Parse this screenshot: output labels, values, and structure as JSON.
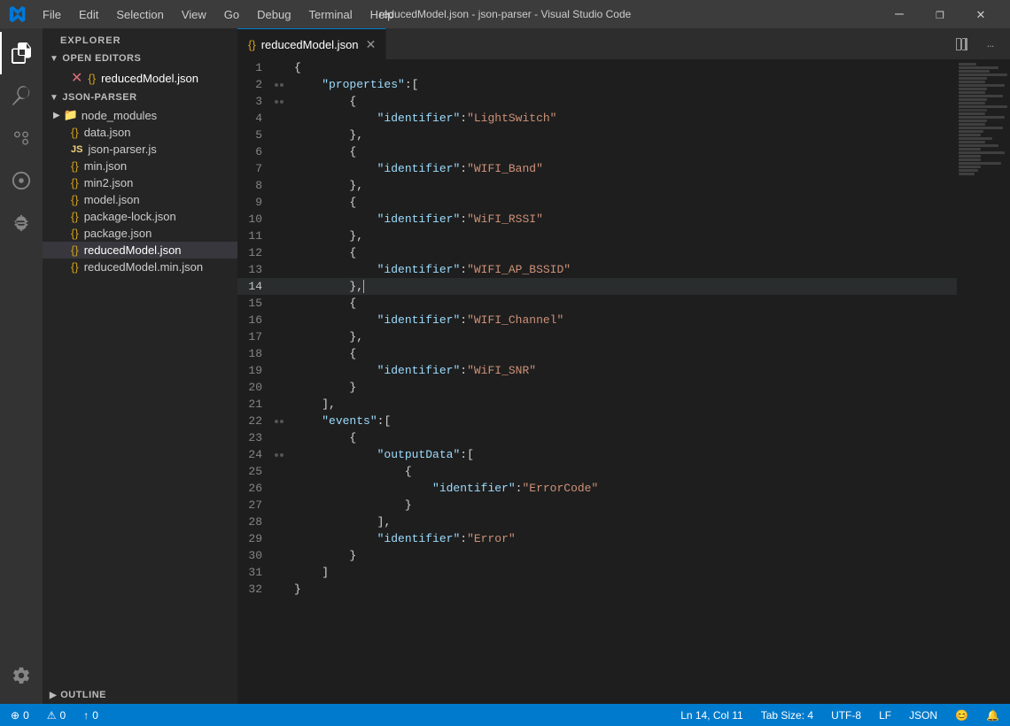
{
  "titlebar": {
    "title": "reducedModel.json - json-parser - Visual Studio Code",
    "menu_items": [
      "File",
      "Edit",
      "Selection",
      "View",
      "Go",
      "Debug",
      "Terminal",
      "Help"
    ],
    "controls": [
      "—",
      "❐",
      "✕"
    ]
  },
  "activity_bar": {
    "icons": [
      {
        "name": "explorer-icon",
        "symbol": "⎘",
        "active": true
      },
      {
        "name": "search-icon",
        "symbol": "🔍",
        "active": false
      },
      {
        "name": "source-control-icon",
        "symbol": "⎇",
        "active": false
      },
      {
        "name": "debug-icon",
        "symbol": "🐛",
        "active": false
      },
      {
        "name": "extensions-icon",
        "symbol": "⊞",
        "active": false
      }
    ],
    "bottom_icons": [
      {
        "name": "settings-icon",
        "symbol": "⚙"
      }
    ]
  },
  "sidebar": {
    "header": "EXPLORER",
    "sections": [
      {
        "name": "OPEN EDITORS",
        "open": true,
        "files": [
          {
            "icon": "{}",
            "name": "reducedModel.json",
            "active": true,
            "modified": true
          }
        ]
      },
      {
        "name": "JSON-PARSER",
        "open": true,
        "files": [
          {
            "type": "folder",
            "icon": "▶",
            "name": "node_modules",
            "indent": 1
          },
          {
            "type": "file",
            "icon": "{}",
            "name": "data.json",
            "indent": 1
          },
          {
            "type": "file",
            "icon": "JS",
            "name": "json-parser.js",
            "indent": 1
          },
          {
            "type": "file",
            "icon": "{}",
            "name": "min.json",
            "indent": 1
          },
          {
            "type": "file",
            "icon": "{}",
            "name": "min2.json",
            "indent": 1
          },
          {
            "type": "file",
            "icon": "{}",
            "name": "model.json",
            "indent": 1
          },
          {
            "type": "file",
            "icon": "{}",
            "name": "package-lock.json",
            "indent": 1
          },
          {
            "type": "file",
            "icon": "{}",
            "name": "package.json",
            "indent": 1
          },
          {
            "type": "file",
            "icon": "{}",
            "name": "reducedModel.json",
            "indent": 1,
            "active": true
          },
          {
            "type": "file",
            "icon": "{}",
            "name": "reducedModel.min.json",
            "indent": 1
          }
        ]
      }
    ],
    "outline_label": "OUTLINE"
  },
  "editor": {
    "tab_filename": "reducedModel.json",
    "lines": [
      {
        "num": 1,
        "text": "{",
        "tokens": [
          {
            "t": "brace",
            "v": "{"
          }
        ]
      },
      {
        "num": 2,
        "text": "    \"properties\":[",
        "tokens": [
          {
            "t": "indent4"
          },
          {
            "t": "key",
            "v": "\"properties\""
          },
          {
            "t": "colon",
            "v": ":"
          },
          {
            "t": "bracket",
            "v": "["
          }
        ]
      },
      {
        "num": 3,
        "text": "        {",
        "tokens": [
          {
            "t": "brace",
            "v": "{"
          }
        ]
      },
      {
        "num": 4,
        "text": "            \"identifier\":\"LightSwitch\"",
        "tokens": [
          {
            "t": "key",
            "v": "\"identifier\""
          },
          {
            "t": "colon",
            "v": ":"
          },
          {
            "t": "str",
            "v": "\"LightSwitch\""
          }
        ]
      },
      {
        "num": 5,
        "text": "        },",
        "tokens": []
      },
      {
        "num": 6,
        "text": "        {",
        "tokens": []
      },
      {
        "num": 7,
        "text": "            \"identifier\":\"WIFI_Band\"",
        "tokens": []
      },
      {
        "num": 8,
        "text": "        },",
        "tokens": []
      },
      {
        "num": 9,
        "text": "        {",
        "tokens": []
      },
      {
        "num": 10,
        "text": "            \"identifier\":\"WiFI_RSSI\"",
        "tokens": []
      },
      {
        "num": 11,
        "text": "        },",
        "tokens": []
      },
      {
        "num": 12,
        "text": "        {",
        "tokens": []
      },
      {
        "num": 13,
        "text": "            \"identifier\":\"WIFI_AP_BSSID\"",
        "tokens": []
      },
      {
        "num": 14,
        "text": "        },",
        "tokens": [],
        "highlight": true
      },
      {
        "num": 15,
        "text": "        {",
        "tokens": []
      },
      {
        "num": 16,
        "text": "            \"identifier\":\"WIFI_Channel\"",
        "tokens": []
      },
      {
        "num": 17,
        "text": "        },",
        "tokens": []
      },
      {
        "num": 18,
        "text": "        {",
        "tokens": []
      },
      {
        "num": 19,
        "text": "            \"identifier\":\"WiFI_SNR\"",
        "tokens": []
      },
      {
        "num": 20,
        "text": "        }",
        "tokens": []
      },
      {
        "num": 21,
        "text": "    ],",
        "tokens": []
      },
      {
        "num": 22,
        "text": "    \"events\":[",
        "tokens": []
      },
      {
        "num": 23,
        "text": "        {",
        "tokens": []
      },
      {
        "num": 24,
        "text": "            \"outputData\":[",
        "tokens": []
      },
      {
        "num": 25,
        "text": "                {",
        "tokens": []
      },
      {
        "num": 26,
        "text": "                    \"identifier\":\"ErrorCode\"",
        "tokens": []
      },
      {
        "num": 27,
        "text": "                }",
        "tokens": []
      },
      {
        "num": 28,
        "text": "            ],",
        "tokens": []
      },
      {
        "num": 29,
        "text": "            \"identifier\":\"Error\"",
        "tokens": []
      },
      {
        "num": 30,
        "text": "        }",
        "tokens": []
      },
      {
        "num": 31,
        "text": "    ]",
        "tokens": []
      },
      {
        "num": 32,
        "text": "}",
        "tokens": []
      }
    ]
  },
  "statusbar": {
    "left": [
      {
        "icon": "⊕",
        "text": "0"
      },
      {
        "icon": "⚠",
        "text": "0"
      },
      {
        "icon": "↑",
        "text": "0"
      }
    ],
    "right": [
      {
        "text": "Ln 14, Col 11"
      },
      {
        "text": "Tab Size: 4"
      },
      {
        "text": "UTF-8"
      },
      {
        "text": "LF"
      },
      {
        "text": "JSON"
      },
      {
        "icon": "😊",
        "text": ""
      },
      {
        "icon": "🔔",
        "text": ""
      }
    ]
  }
}
